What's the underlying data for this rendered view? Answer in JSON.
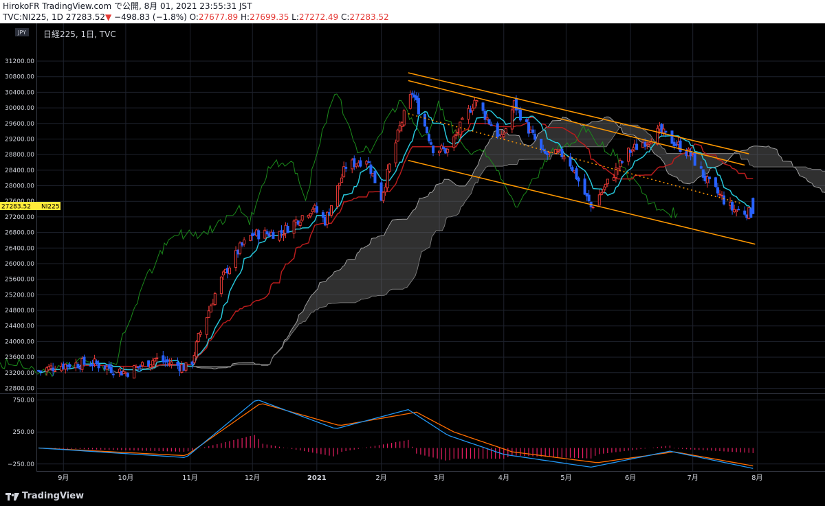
{
  "header": {
    "line1": "HirokoFR TradingView.com で公開, 8月 01, 2021 23:55:31 JST",
    "symbol": "TVC:NI225, 1D 27283.52",
    "change": "−498.83 (−1.8%)",
    "o_label": "O:",
    "o": "27677.89",
    "h_label": "H:",
    "h": "27699.35",
    "l_label": "L:",
    "l": "27272.49",
    "c_label": "C:",
    "c": "27283.52"
  },
  "legend": "日経225, 1日, TVC",
  "currency_badge": "JPY",
  "last_price_label": "27283.52",
  "last_price_symbol": "NI225",
  "footer": {
    "brand": "TradingView"
  },
  "colors": {
    "background": "#000000",
    "bull": "#e53935",
    "bear": "#2962ff",
    "tenkan": "#26c6da",
    "kijun": "#b71c1c",
    "chikou": "#1b8a1b",
    "cloud": "#6b6b6b",
    "trend": "#ff9800",
    "macd": "#2196f3",
    "signal": "#ff6d00",
    "hist": "#e91e63",
    "price_badge": "#ffeb3b"
  },
  "chart_data": [
    {
      "type": "candlestick",
      "title": "日経225, 1日, TVC",
      "y_ticks": [
        "31200.00",
        "30800.00",
        "30400.00",
        "30000.00",
        "29600.00",
        "29200.00",
        "28800.00",
        "28400.00",
        "28000.00",
        "27600.00",
        "27200.00",
        "26800.00",
        "26400.00",
        "26000.00",
        "25600.00",
        "25200.00",
        "24800.00",
        "24400.00",
        "24000.00",
        "23600.00",
        "23200.00",
        "22800.00"
      ],
      "ylim": [
        22650,
        31500
      ],
      "x_ticks": [
        "9月",
        "10月",
        "11月",
        "12月",
        "2021",
        "2月",
        "3月",
        "4月",
        "5月",
        "6月",
        "7月",
        "8月"
      ],
      "grid": true,
      "close_path": [
        [
          "2020-08-20",
          23250
        ],
        [
          "2020-09-01",
          23400
        ],
        [
          "2020-09-15",
          23450
        ],
        [
          "2020-10-01",
          23200
        ],
        [
          "2020-10-15",
          23550
        ],
        [
          "2020-11-01",
          23300
        ],
        [
          "2020-11-05",
          24100
        ],
        [
          "2020-11-15",
          25500
        ],
        [
          "2020-11-25",
          26400
        ],
        [
          "2020-12-01",
          26750
        ],
        [
          "2020-12-15",
          26800
        ],
        [
          "2020-12-30",
          27444
        ],
        [
          "2021-01-05",
          27100
        ],
        [
          "2021-01-15",
          28500
        ],
        [
          "2021-01-25",
          28700
        ],
        [
          "2021-02-01",
          27700
        ],
        [
          "2021-02-10",
          29500
        ],
        [
          "2021-02-16",
          30400
        ],
        [
          "2021-02-26",
          28966
        ],
        [
          "2021-03-05",
          28900
        ],
        [
          "2021-03-18",
          30200
        ],
        [
          "2021-03-31",
          29178
        ],
        [
          "2021-04-06",
          30100
        ],
        [
          "2021-04-20",
          28800
        ],
        [
          "2021-05-01",
          28800
        ],
        [
          "2021-05-13",
          27450
        ],
        [
          "2021-05-31",
          28860
        ],
        [
          "2021-06-15",
          29400
        ],
        [
          "2021-06-30",
          28791
        ],
        [
          "2021-07-08",
          28100
        ],
        [
          "2021-07-20",
          27400
        ],
        [
          "2021-07-30",
          27283.52
        ]
      ],
      "trend_channel": {
        "upper_1": [
          [
            "2021-02-14",
            30900
          ],
          [
            "2021-07-28",
            28820
          ]
        ],
        "upper_2": [
          [
            "2021-02-14",
            30700
          ],
          [
            "2021-07-26",
            28530
          ]
        ],
        "middle_dotted": [
          [
            "2021-02-14",
            29850
          ],
          [
            "2021-07-24",
            27550
          ]
        ],
        "lower": [
          [
            "2021-02-14",
            28650
          ],
          [
            "2021-07-31",
            26500
          ]
        ]
      }
    },
    {
      "type": "line",
      "title": "MACD",
      "y_ticks": [
        "750.00",
        "250.00",
        "−250.00"
      ],
      "ylim": [
        -360,
        800
      ],
      "series": [
        {
          "values_by_date": [
            [
              "2020-08-20",
              0
            ],
            [
              "2020-10-30",
              -150
            ],
            [
              "2020-12-03",
              760
            ],
            [
              "2021-01-10",
              300
            ],
            [
              "2021-02-14",
              600
            ],
            [
              "2021-03-05",
              200
            ],
            [
              "2021-04-01",
              -100
            ],
            [
              "2021-05-13",
              -300
            ],
            [
              "2021-06-20",
              -50
            ],
            [
              "2021-07-30",
              -320
            ]
          ]
        },
        {
          "values_by_date": [
            [
              "2020-08-20",
              0
            ],
            [
              "2020-10-30",
              -120
            ],
            [
              "2020-12-05",
              700
            ],
            [
              "2021-01-12",
              350
            ],
            [
              "2021-02-18",
              560
            ],
            [
              "2021-03-08",
              250
            ],
            [
              "2021-04-05",
              -60
            ],
            [
              "2021-05-16",
              -230
            ],
            [
              "2021-06-22",
              -60
            ],
            [
              "2021-07-30",
              -280
            ]
          ]
        }
      ]
    }
  ]
}
